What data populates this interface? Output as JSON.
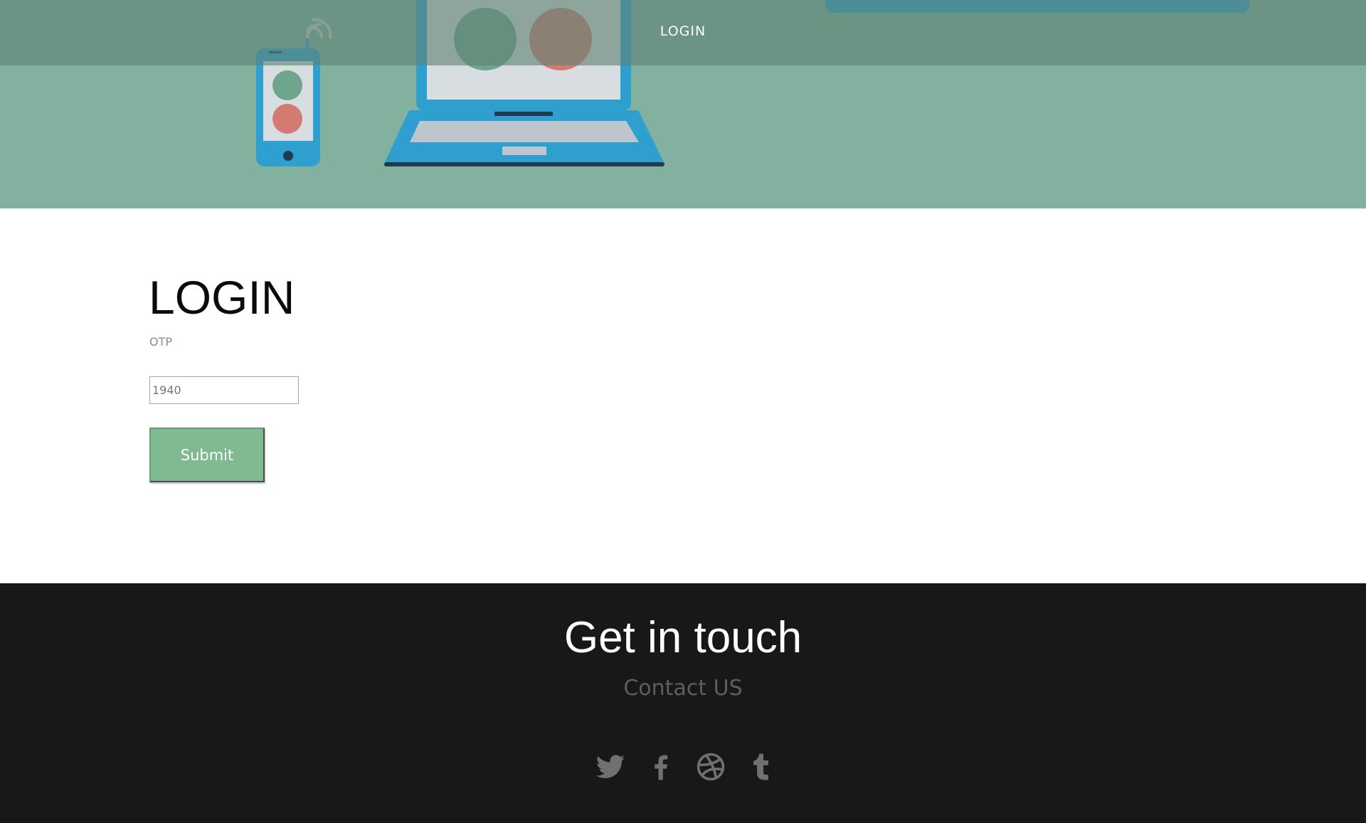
{
  "nav": {
    "login_label": "LOGIN"
  },
  "login": {
    "title": "LOGIN",
    "otp_label": "OTP",
    "otp_value": "1940",
    "submit_label": "Submit"
  },
  "footer": {
    "title": "Get in touch",
    "subtitle": "Contact US",
    "social": [
      "twitter-icon",
      "facebook-icon",
      "dribbble-icon",
      "tumblr-icon"
    ]
  },
  "colors": {
    "hero_bg": "#82b19f",
    "navbar_overlay": "#6f9b8a",
    "device_blue": "#2f9fd0",
    "circle_green": "#6fa58d",
    "circle_red": "#d37b72",
    "submit_bg": "#7fba91",
    "footer_bg": "#181818",
    "footer_subtitle": "#5e5e5e",
    "social_icon": "#707070"
  }
}
